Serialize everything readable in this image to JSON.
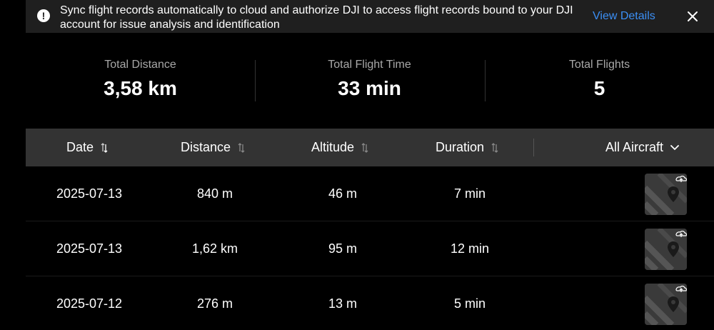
{
  "banner": {
    "message": "Sync flight records automatically to cloud and authorize DJI to access flight records bound to your DJI account for issue analysis and identification",
    "link_label": "View Details",
    "info_glyph": "!"
  },
  "stats": [
    {
      "label": "Total Distance",
      "value": "3,58 km"
    },
    {
      "label": "Total Flight Time",
      "value": "33 min"
    },
    {
      "label": "Total Flights",
      "value": "5"
    }
  ],
  "table": {
    "columns": [
      "Date",
      "Distance",
      "Altitude",
      "Duration"
    ],
    "filter_label": "All Aircraft",
    "rows": [
      {
        "date": "2025-07-13",
        "distance": "840 m",
        "altitude": "46 m",
        "duration": "7 min"
      },
      {
        "date": "2025-07-13",
        "distance": "1,62 km",
        "altitude": "95 m",
        "duration": "12 min"
      },
      {
        "date": "2025-07-12",
        "distance": "276 m",
        "altitude": "13 m",
        "duration": "5 min"
      }
    ]
  },
  "icons": {
    "banner": "info-icon",
    "close": "close-icon",
    "sort": "sort-icon",
    "filter": "chevron-down-icon",
    "upload": "cloud-upload-icon",
    "map_pin": "map-pin-icon"
  },
  "colors": {
    "accent": "#3b8ff5",
    "banner_bg": "#1f1f1f",
    "header_bg": "#333333",
    "muted_text": "#a8a8a8"
  }
}
